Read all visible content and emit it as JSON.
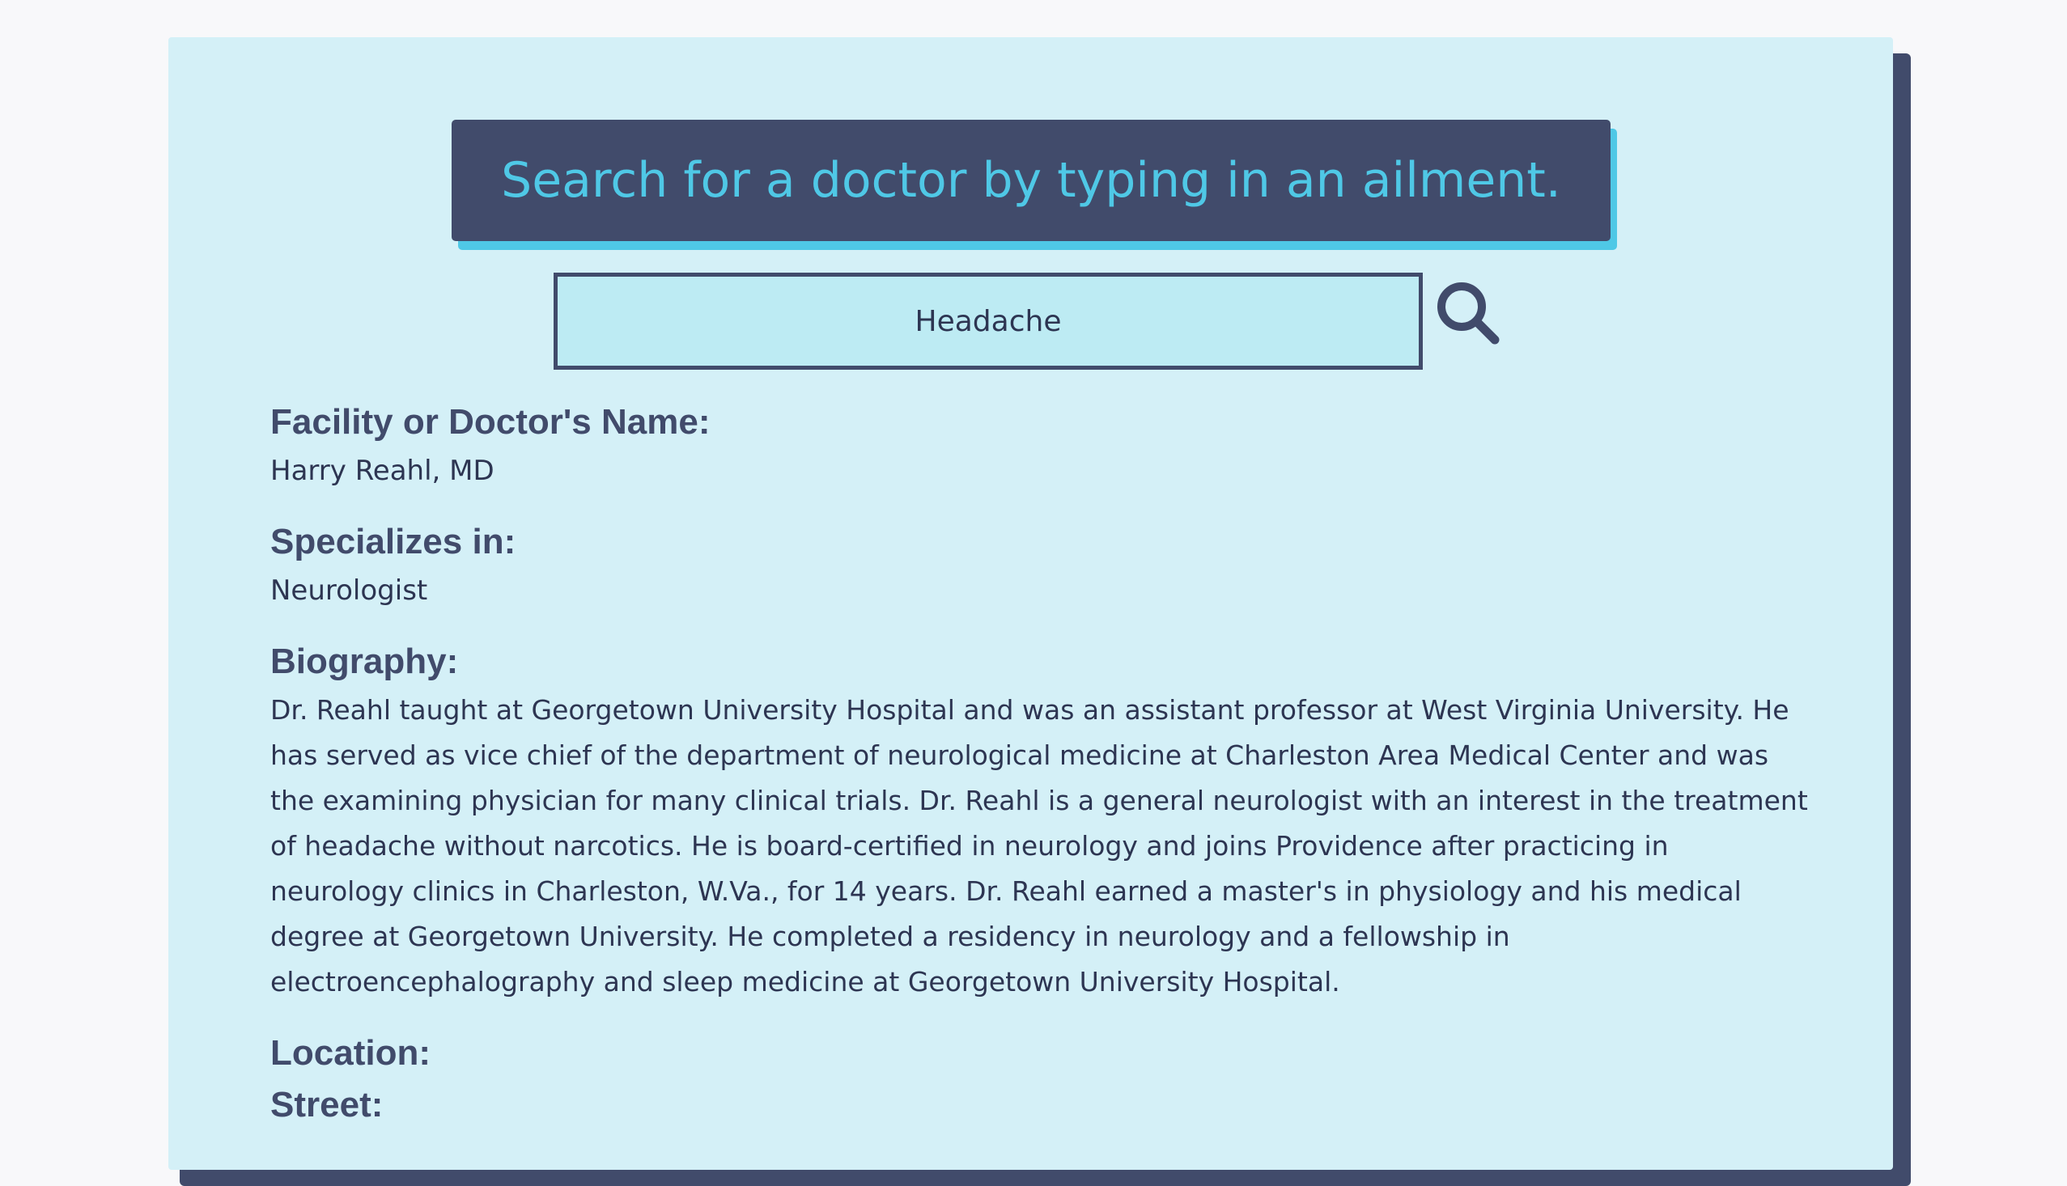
{
  "header": {
    "title": "Search for a doctor by typing in an ailment."
  },
  "search": {
    "value": "Headache",
    "icon": "search-icon"
  },
  "result": {
    "name_label": "Facility or Doctor's Name:",
    "name_value": "Harry Reahl, MD",
    "specialty_label": "Specializes in:",
    "specialty_value": "Neurologist",
    "bio_label": "Biography:",
    "bio_value": "Dr. Reahl taught at Georgetown University Hospital and was an assistant professor at West Virginia University. He has served as vice chief of the department of neurological medicine at Charleston Area Medical Center and was the examining physician for many clinical trials. Dr. Reahl is a general neurologist with an interest in the treatment of headache without narcotics. He is board-certified in neurology and joins Providence after practicing in neurology clinics in Charleston, W.Va., for 14 years. Dr. Reahl earned a master's in physiology and his medical degree at Georgetown University. He completed a residency in neurology and a fellowship in electroencephalography and sleep medicine at Georgetown University Hospital.",
    "location_label": "Location:",
    "street_label": "Street:"
  },
  "colors": {
    "page_background": "#f8f8fa",
    "card_background": "#d4f0f7",
    "navy": "#414b6b",
    "accent_cyan": "#4fc8e6",
    "input_background": "#bdebf3"
  }
}
